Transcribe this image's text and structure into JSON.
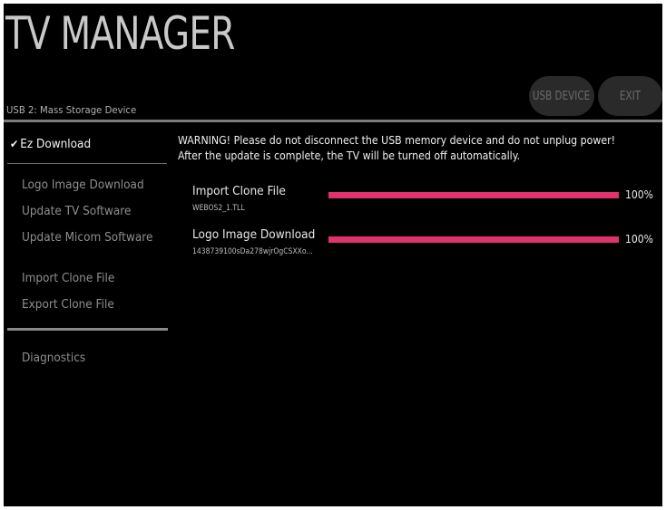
{
  "header": {
    "title": "TV MANAGER",
    "device_label": "USB 2: Mass Storage Device",
    "buttons": {
      "usb_device": "USB DEVICE",
      "exit": "EXIT"
    }
  },
  "menu": {
    "selected": {
      "check": "✔",
      "label": "Ez Download"
    },
    "items": [
      "Logo Image Download",
      "Update TV Software",
      "Update Micom Software",
      "Import Clone File",
      "Export Clone File",
      "Diagnostics"
    ]
  },
  "content": {
    "warning_line1": "WARNING! Please do not disconnect the USB memory device and do not unplug power!",
    "warning_line2": "After the update is complete, the TV will be turned off automatically.",
    "progress": [
      {
        "name": "Import Clone File",
        "file": "WEBOS2_1.TLL",
        "percent_label": "100%",
        "fraction": 1.0
      },
      {
        "name": "Logo Image Download",
        "file": "1438739100sDa278wjrOgCSXXo...",
        "percent_label": "100%",
        "fraction": 1.0
      }
    ]
  },
  "colors": {
    "accent": "#e0336d",
    "background": "#000000",
    "text": "#f0f0f0",
    "muted": "#8e8e8e"
  }
}
